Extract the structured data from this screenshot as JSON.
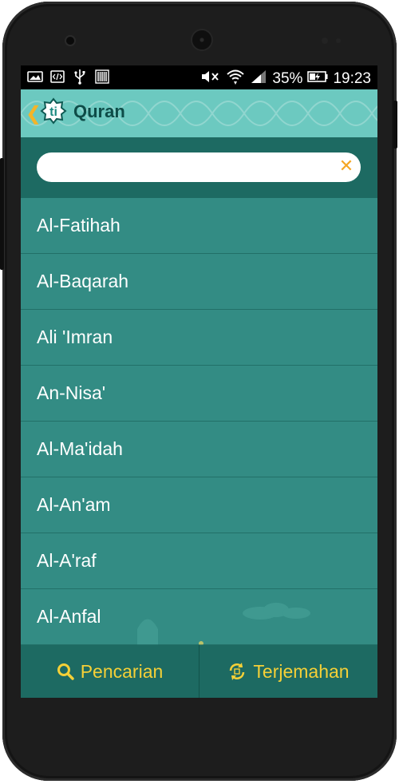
{
  "status_bar": {
    "battery": "35%",
    "time": "19:23",
    "left_icons": [
      "photo-icon",
      "code-icon",
      "usb-icon",
      "barcode-icon"
    ],
    "right_icons": [
      "mute-icon",
      "wifi-icon",
      "signal-icon",
      "battery-icon"
    ]
  },
  "toolbar": {
    "title": "Quran",
    "logo_text": "ti",
    "accent_color": "#f5b427",
    "background_color": "#6cc9c0"
  },
  "search": {
    "value": "",
    "placeholder": "",
    "clear_icon": "close-icon"
  },
  "surahs": [
    {
      "name": "Al-Fatihah"
    },
    {
      "name": "Al-Baqarah"
    },
    {
      "name": "Ali 'Imran"
    },
    {
      "name": "An-Nisa'"
    },
    {
      "name": "Al-Ma'idah"
    },
    {
      "name": "Al-An'am"
    },
    {
      "name": "Al-A'raf"
    },
    {
      "name": "Al-Anfal"
    }
  ],
  "bottom_nav": {
    "search_label": "Pencarian",
    "translation_label": "Terjemahan",
    "search_icon": "search-icon",
    "translation_icon": "refresh-icon",
    "label_color": "#f5d037"
  },
  "colors": {
    "list_background": "#338c84",
    "dark_bar": "#1d6a62"
  }
}
